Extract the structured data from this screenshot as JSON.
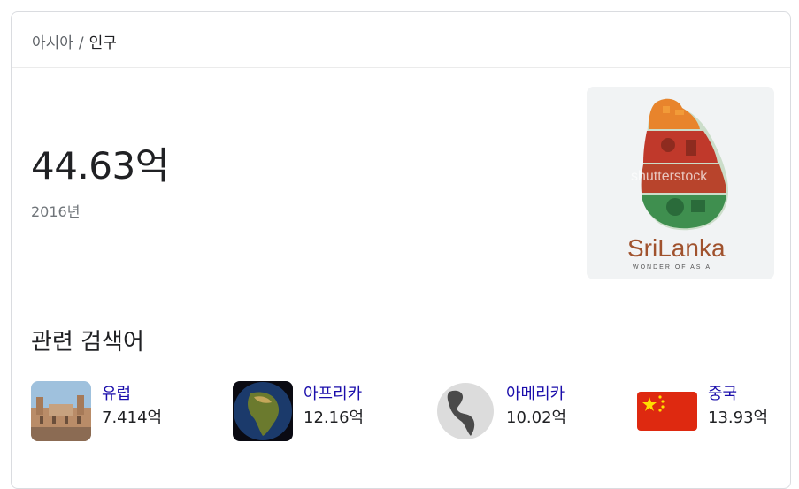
{
  "breadcrumb": {
    "parent": "아시아",
    "separator": "/",
    "current": "인구"
  },
  "population": {
    "value": "44.63억",
    "year": "2016년"
  },
  "hero_image": {
    "caption": "SriLanka",
    "subcaption": "WONDER OF ASIA",
    "watermark": "shutterstock"
  },
  "related": {
    "title": "관련 검색어",
    "items": [
      {
        "name": "유럽",
        "value": "7.414억",
        "icon": "europe-building-image"
      },
      {
        "name": "아프리카",
        "value": "12.16억",
        "icon": "africa-globe-image"
      },
      {
        "name": "아메리카",
        "value": "10.02억",
        "icon": "americas-globe-image"
      },
      {
        "name": "중국",
        "value": "13.93억",
        "icon": "china-flag-image"
      }
    ]
  },
  "colors": {
    "link": "#1a0dab",
    "text": "#202124",
    "muted": "#70757a",
    "border": "#dadce0"
  }
}
